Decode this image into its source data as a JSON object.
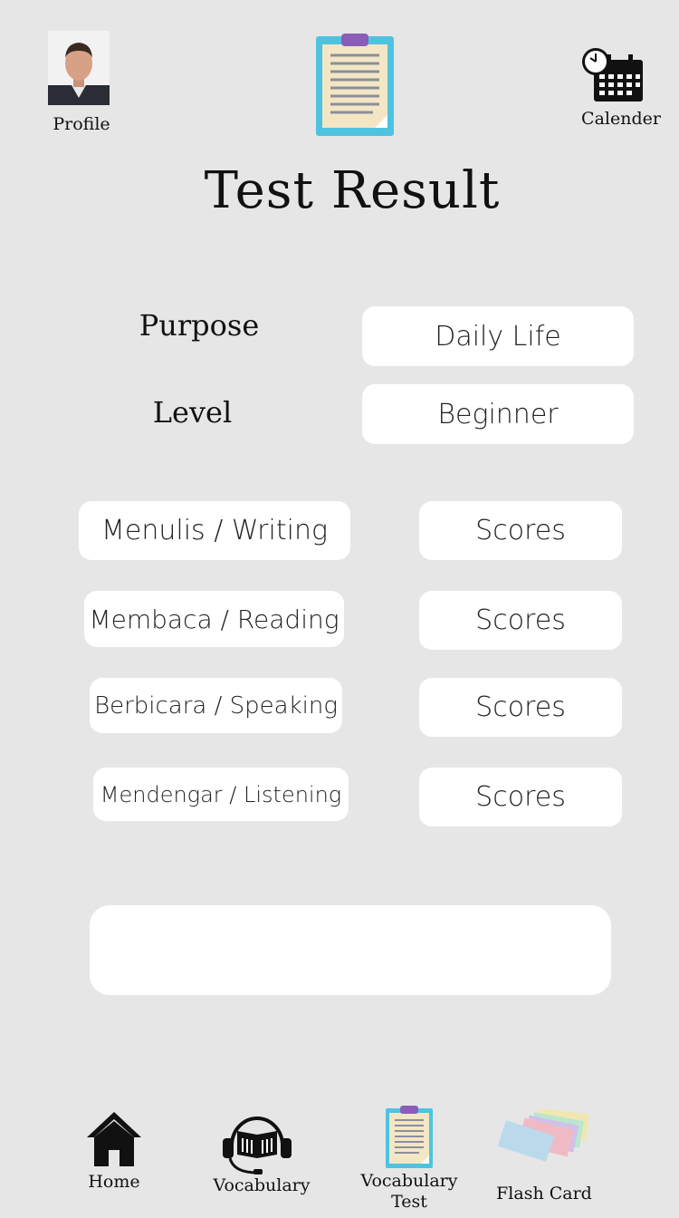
{
  "header": {
    "profile_label": "Profile",
    "calendar_label": "Calender",
    "title": "Test Result"
  },
  "info": {
    "purpose_label": "Purpose",
    "purpose_value": "Daily Life",
    "level_label": "Level",
    "level_value": "Beginner"
  },
  "skills": [
    {
      "name": "Menulis / Writing",
      "score": "Scores"
    },
    {
      "name": "Membaca / Reading",
      "score": "Scores"
    },
    {
      "name": "Berbicara / Speaking",
      "score": "Scores"
    },
    {
      "name": "Mendengar / Listening",
      "score": "Scores"
    }
  ],
  "summary_box": "",
  "bottom_nav": [
    {
      "label": "Home",
      "icon": "home-icon"
    },
    {
      "label": "Vocabulary",
      "icon": "headset-book-icon"
    },
    {
      "label": "Vocabulary\nTest",
      "icon": "clipboard-icon"
    },
    {
      "label": "Flash Card",
      "icon": "flash-cards-icon"
    }
  ]
}
